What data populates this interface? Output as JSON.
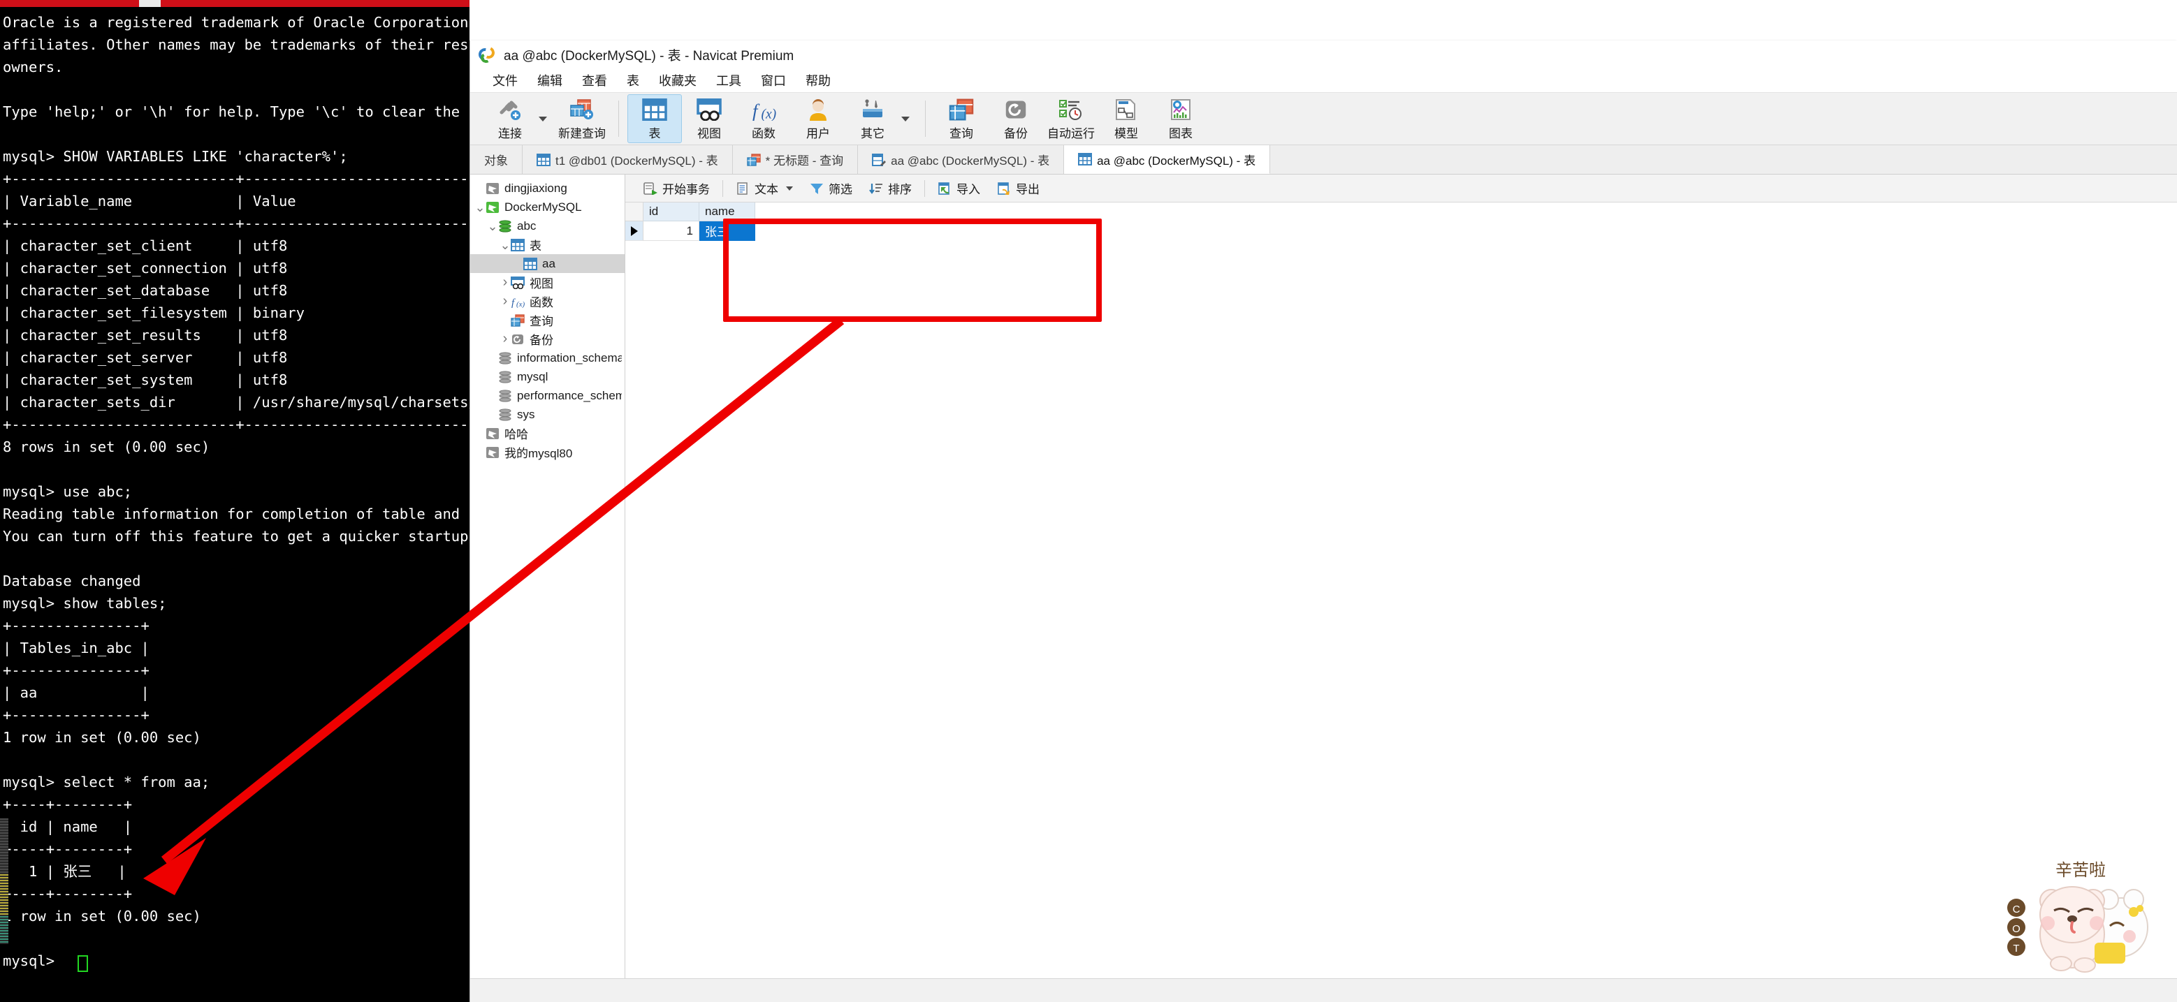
{
  "terminal": {
    "lines": [
      "Oracle is a registered trademark of Oracle Corporation and/or its",
      "affiliates. Other names may be trademarks of their respective",
      "owners.",
      "",
      "Type 'help;' or '\\h' for help. Type '\\c' to clear the current input statement.",
      "",
      "mysql> SHOW VARIABLES LIKE 'character%';",
      "+--------------------------+----------------------------+",
      "| Variable_name            | Value                      |",
      "+--------------------------+----------------------------+",
      "| character_set_client     | utf8                       |",
      "| character_set_connection | utf8                       |",
      "| character_set_database   | utf8                       |",
      "| character_set_filesystem | binary                     |",
      "| character_set_results    | utf8                       |",
      "| character_set_server     | utf8                       |",
      "| character_set_system     | utf8                       |",
      "| character_sets_dir       | /usr/share/mysql/charsets/ |",
      "+--------------------------+----------------------------+",
      "8 rows in set (0.00 sec)",
      "",
      "mysql> use abc;",
      "Reading table information for completion of table and column names",
      "You can turn off this feature to get a quicker startup with -A",
      "",
      "Database changed",
      "mysql> show tables;",
      "+---------------+",
      "| Tables_in_abc |",
      "+---------------+",
      "| aa            |",
      "+---------------+",
      "1 row in set (0.00 sec)",
      "",
      "mysql> select * from aa;",
      "+----+--------+",
      "| id | name   |",
      "+----+--------+",
      "|  1 | 张三   |",
      "+----+--------+",
      "1 row in set (0.00 sec)",
      "",
      "mysql>"
    ]
  },
  "window": {
    "title": "aa @abc (DockerMySQL) - 表 - Navicat Premium",
    "logo_icon": "navicat-logo-icon"
  },
  "menubar": {
    "items": [
      {
        "label": "文件",
        "name": "menu-file"
      },
      {
        "label": "编辑",
        "name": "menu-edit"
      },
      {
        "label": "查看",
        "name": "menu-view"
      },
      {
        "label": "表",
        "name": "menu-table"
      },
      {
        "label": "收藏夹",
        "name": "menu-favorites"
      },
      {
        "label": "工具",
        "name": "menu-tools"
      },
      {
        "label": "窗口",
        "name": "menu-window"
      },
      {
        "label": "帮助",
        "name": "menu-help"
      }
    ]
  },
  "toolbar": {
    "items": [
      {
        "label": "连接",
        "icon": "connection-plug-icon",
        "active": false,
        "caret": true
      },
      {
        "label": "新建查询",
        "icon": "new-query-icon",
        "active": false,
        "caret": false
      },
      {
        "label": "表",
        "icon": "table-icon",
        "active": true,
        "caret": false
      },
      {
        "label": "视图",
        "icon": "view-icon",
        "active": false,
        "caret": false
      },
      {
        "label": "函数",
        "icon": "function-fx-icon",
        "active": false,
        "caret": false
      },
      {
        "label": "用户",
        "icon": "user-icon",
        "active": false,
        "caret": false
      },
      {
        "label": "其它",
        "icon": "other-tools-icon",
        "active": false,
        "caret": true
      },
      {
        "label": "查询",
        "icon": "query-icon",
        "active": false,
        "caret": false
      },
      {
        "label": "备份",
        "icon": "backup-icon",
        "active": false,
        "caret": false
      },
      {
        "label": "自动运行",
        "icon": "automation-icon",
        "active": false,
        "caret": false
      },
      {
        "label": "模型",
        "icon": "model-icon",
        "active": false,
        "caret": false
      },
      {
        "label": "图表",
        "icon": "chart-icon",
        "active": false,
        "caret": false
      }
    ]
  },
  "tabs": [
    {
      "label": "对象",
      "icon": "none",
      "active": false,
      "name": "tab-objects"
    },
    {
      "label": "t1 @db01 (DockerMySQL) - 表",
      "icon": "table-icon",
      "active": false,
      "name": "tab-t1-db01"
    },
    {
      "label": "* 无标题 - 查询",
      "icon": "query-icon",
      "active": false,
      "name": "tab-untitled-query"
    },
    {
      "label": "aa @abc (DockerMySQL) - 表",
      "icon": "table-design-icon",
      "active": false,
      "name": "tab-aa-abc-design"
    },
    {
      "label": "aa @abc (DockerMySQL) - 表",
      "icon": "table-icon",
      "active": true,
      "name": "tab-aa-abc-data"
    }
  ],
  "sidebar": {
    "items": [
      {
        "label": "dingjiaxiong",
        "indent": 0,
        "icon": "connection-icon",
        "twisty": "",
        "selected": false
      },
      {
        "label": "DockerMySQL",
        "indent": 0,
        "icon": "connection-icon-green",
        "twisty": "v",
        "selected": false
      },
      {
        "label": "abc",
        "indent": 1,
        "icon": "database-icon-green",
        "twisty": "v",
        "selected": false
      },
      {
        "label": "表",
        "indent": 2,
        "icon": "table-icon",
        "twisty": "v",
        "selected": false
      },
      {
        "label": "aa",
        "indent": 3,
        "icon": "table-icon",
        "twisty": "",
        "selected": true
      },
      {
        "label": "视图",
        "indent": 2,
        "icon": "view-icon",
        "twisty": ">",
        "selected": false
      },
      {
        "label": "函数",
        "indent": 2,
        "icon": "function-fx-icon",
        "twisty": ">",
        "selected": false
      },
      {
        "label": "查询",
        "indent": 2,
        "icon": "query-icon",
        "twisty": "",
        "selected": false
      },
      {
        "label": "备份",
        "indent": 2,
        "icon": "backup-icon",
        "twisty": ">",
        "selected": false
      },
      {
        "label": "information_schema",
        "indent": 1,
        "icon": "database-icon",
        "twisty": "",
        "selected": false
      },
      {
        "label": "mysql",
        "indent": 1,
        "icon": "database-icon",
        "twisty": "",
        "selected": false
      },
      {
        "label": "performance_schema",
        "indent": 1,
        "icon": "database-icon",
        "twisty": "",
        "selected": false
      },
      {
        "label": "sys",
        "indent": 1,
        "icon": "database-icon",
        "twisty": "",
        "selected": false
      },
      {
        "label": "哈哈",
        "indent": 0,
        "icon": "connection-icon",
        "twisty": "",
        "selected": false
      },
      {
        "label": "我的mysql80",
        "indent": 0,
        "icon": "connection-icon",
        "twisty": "",
        "selected": false
      }
    ]
  },
  "grid_toolbar": {
    "items": [
      {
        "label": "开始事务",
        "icon": "begin-transaction-icon",
        "caret": false,
        "sep_after": true
      },
      {
        "label": "文本",
        "icon": "text-icon",
        "caret": true,
        "sep_after": false
      },
      {
        "label": "筛选",
        "icon": "filter-icon",
        "caret": false,
        "sep_after": false
      },
      {
        "label": "排序",
        "icon": "sort-icon",
        "caret": false,
        "sep_after": true
      },
      {
        "label": "导入",
        "icon": "import-icon",
        "caret": false,
        "sep_after": false
      },
      {
        "label": "导出",
        "icon": "export-icon",
        "caret": false,
        "sep_after": false
      }
    ]
  },
  "data_grid": {
    "columns": [
      "id",
      "name"
    ],
    "rows": [
      {
        "id": "1",
        "name": "张三",
        "selected_column": "name",
        "current": true
      }
    ]
  },
  "sticker": {
    "caption": "辛苦啦",
    "name": "cute-bear-sticker"
  },
  "annotation": {
    "box_color": "#ee0000",
    "arrow_color": "#ee0000"
  }
}
